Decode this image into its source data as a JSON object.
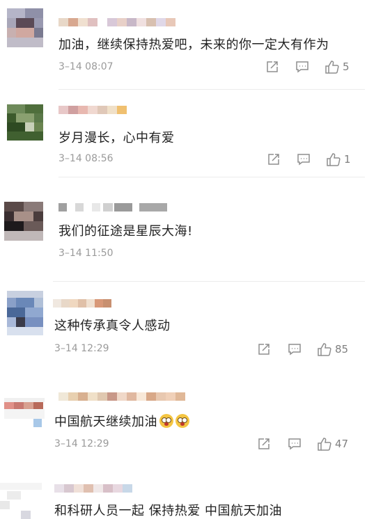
{
  "comments": [
    {
      "text": "加油，继续保持热爱吧，未来的你一定大有作为",
      "time": "3–14 08:07",
      "likes": "5"
    },
    {
      "text": "岁月漫长，心中有爱",
      "time": "3–14 08:56",
      "likes": "1"
    },
    {
      "text": "我们的征途是星辰大海!",
      "time": "3–14 11:50",
      "likes": ""
    },
    {
      "text": "这种传承真令人感动",
      "time": "3–14 12:29",
      "likes": "85"
    },
    {
      "text": "中国航天继续加油",
      "time": "3–14 12:29",
      "likes": "47",
      "emoji": [
        "face-screaming-emoji",
        "face-screaming-emoji"
      ]
    },
    {
      "text": "和科研人员一起 保持热爱 中国航天加油",
      "time": "",
      "likes": ""
    }
  ],
  "icons": [
    "share-icon",
    "reply-icon",
    "thumbs-up-icon"
  ],
  "colors": {
    "text": "#222222",
    "meta": "#9a9a9a",
    "icon": "#8e8e8e",
    "divider": "#ececec"
  }
}
